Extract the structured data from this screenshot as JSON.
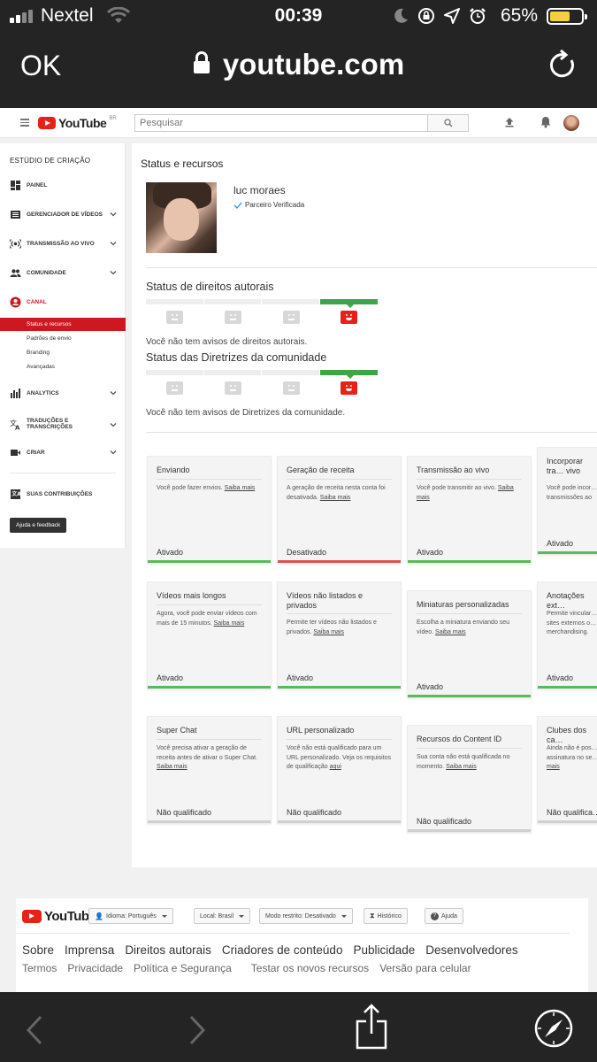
{
  "status_bar": {
    "carrier": "Nextel",
    "time": "00:39",
    "battery_percent": "65%",
    "battery_level": 0.65,
    "battery_color": "#f4d03f"
  },
  "browser": {
    "done_label": "OK",
    "url": "youtube.com"
  },
  "yt_header": {
    "logo_text": "YouTube",
    "region": "BR",
    "search_placeholder": "Pesquisar"
  },
  "sidebar": {
    "heading": "ESTÚDIO DE CRIAÇÃO",
    "items": [
      {
        "label": "PAINEL",
        "icon": "dashboard-icon"
      },
      {
        "label": "GERENCIADOR DE VÍDEOS",
        "icon": "video-manager-icon"
      },
      {
        "label": "TRANSMISSÃO AO VIVO",
        "icon": "live-icon"
      },
      {
        "label": "COMUNIDADE",
        "icon": "community-icon"
      },
      {
        "label": "CANAL",
        "icon": "channel-icon"
      },
      {
        "label": "ANALYTICS",
        "icon": "analytics-icon"
      },
      {
        "label": "TRADUÇÕES E TRANSCRIÇÕES",
        "icon": "translate-icon"
      },
      {
        "label": "CRIAR",
        "icon": "create-icon"
      },
      {
        "label": "SUAS CONTRIBUIÇÕES",
        "icon": "contributions-icon"
      }
    ],
    "sub_items": [
      "Status e recursos",
      "Padrões de envio",
      "Branding",
      "Avançadas"
    ],
    "help_button": "Ajuda e feedback",
    "accent_color": "#cc181e"
  },
  "main": {
    "title": "Status e recursos",
    "channel_name": "luc moraes",
    "verified_label": "Parceiro Verificada",
    "copyright": {
      "title": "Status de direitos autorais",
      "message": "Você não tem avisos de direitos autorais."
    },
    "guidelines": {
      "title": "Status das Diretrizes da comunidade",
      "message": "Você não tem avisos de Diretrizes da comunidade."
    },
    "cards": [
      {
        "title": "Enviando",
        "desc": "Você pode fazer envios.",
        "link": "Saiba mais",
        "status": "Ativado",
        "bar": "green"
      },
      {
        "title": "Geração de receita",
        "desc": "A geração de receita nesta conta foi desativada.",
        "link": "Saiba mais",
        "status": "Desativado",
        "bar": "red"
      },
      {
        "title": "Transmissão ao vivo",
        "desc": "Você pode transmitir ao vivo.",
        "link": "Saiba mais",
        "status": "Ativado",
        "bar": "green"
      },
      {
        "title": "Incorporar tra… vivo",
        "desc": "Você pode incor… transmissões ao",
        "link": "",
        "status": "Ativado",
        "bar": "green"
      },
      {
        "title": "Vídeos mais longos",
        "desc": "Agora, você pode enviar vídeos com mais de 15 minutos.",
        "link": "Saiba mais",
        "status": "Ativado",
        "bar": "green"
      },
      {
        "title": "Vídeos não listados e privados",
        "desc": "Permite ter vídeos não listados e privados.",
        "link": "Saiba mais",
        "status": "Ativado",
        "bar": "green"
      },
      {
        "title": "Miniaturas personalizadas",
        "desc": "Escolha a miniatura enviando seu vídeo.",
        "link": "Saiba mais",
        "status": "Ativado",
        "bar": "green"
      },
      {
        "title": "Anotações ext…",
        "desc": "Permite vincular… sites externos o… merchandising.",
        "link": "",
        "status": "Ativado",
        "bar": "green"
      },
      {
        "title": "Super Chat",
        "desc": "Você precisa ativar a geração de receita antes de ativar o Super Chat.",
        "link": "Saiba mais",
        "status": "Não qualificado",
        "bar": "grey"
      },
      {
        "title": "URL personalizado",
        "desc": "Você não está qualificado para um URL personalizado. Veja os requisitos de qualificação",
        "link": "aqui",
        "status": "Não qualificado",
        "bar": "grey"
      },
      {
        "title": "Recursos do Content ID",
        "desc": "Sua conta não está qualificada no momento.",
        "link": "Saiba mais",
        "status": "Não qualificado",
        "bar": "grey"
      },
      {
        "title": "Clubes dos ca…",
        "desc": "Ainda não é pos… assinatura no se…",
        "link": "mais",
        "status": "Não qualifica…",
        "bar": "grey"
      }
    ]
  },
  "footer": {
    "logo_text": "YouTube",
    "language": "Idioma: Português",
    "location": "Local: Brasil",
    "restricted": "Modo restrito: Desativado",
    "history": "Histórico",
    "help": "Ajuda",
    "links_row1": [
      "Sobre",
      "Imprensa",
      "Direitos autorais",
      "Criadores de conteúdo",
      "Publicidade",
      "Desenvolvedores"
    ],
    "links_row2": [
      "Termos",
      "Privacidade",
      "Política e Segurança",
      "Testar os novos recursos",
      "Versão para celular"
    ]
  }
}
